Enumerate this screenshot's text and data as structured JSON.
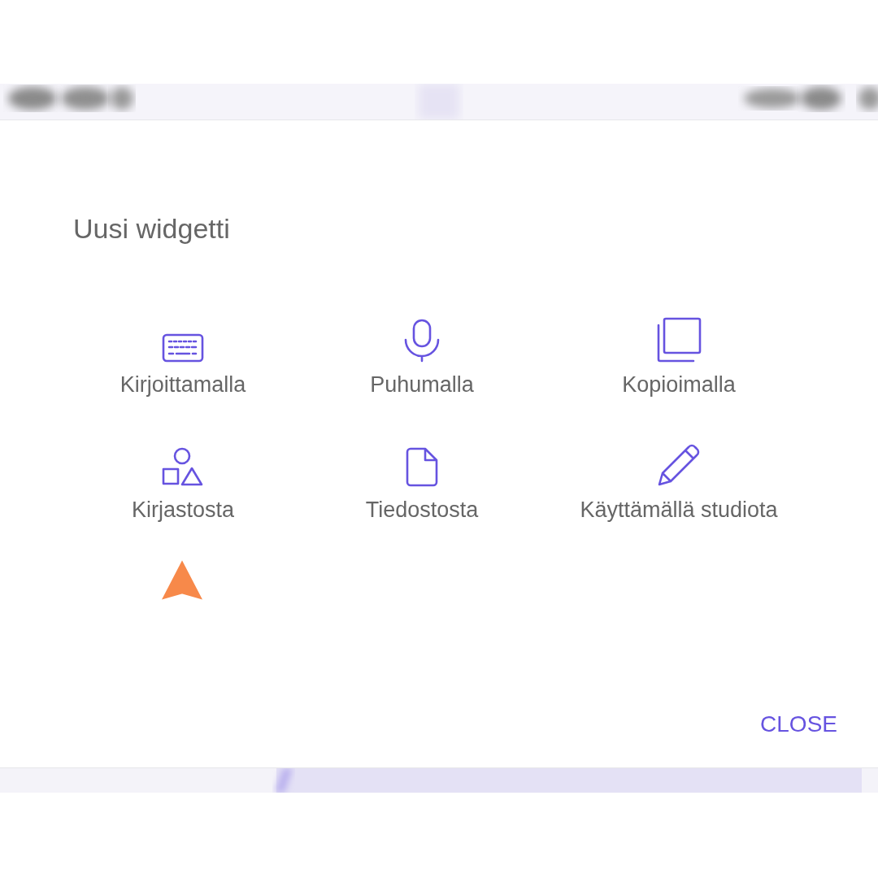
{
  "dialog": {
    "title": "Uusi widgetti",
    "options": [
      {
        "kind": "keyboard",
        "label": "Kirjoittamalla"
      },
      {
        "kind": "microphone",
        "label": "Puhumalla"
      },
      {
        "kind": "copy",
        "label": "Kopioimalla"
      },
      {
        "kind": "shapes",
        "label": "Kirjastosta"
      },
      {
        "kind": "file",
        "label": "Tiedostosta"
      },
      {
        "kind": "pencil",
        "label": "Käyttämällä studiota"
      }
    ],
    "close_button": "CLOSE"
  }
}
